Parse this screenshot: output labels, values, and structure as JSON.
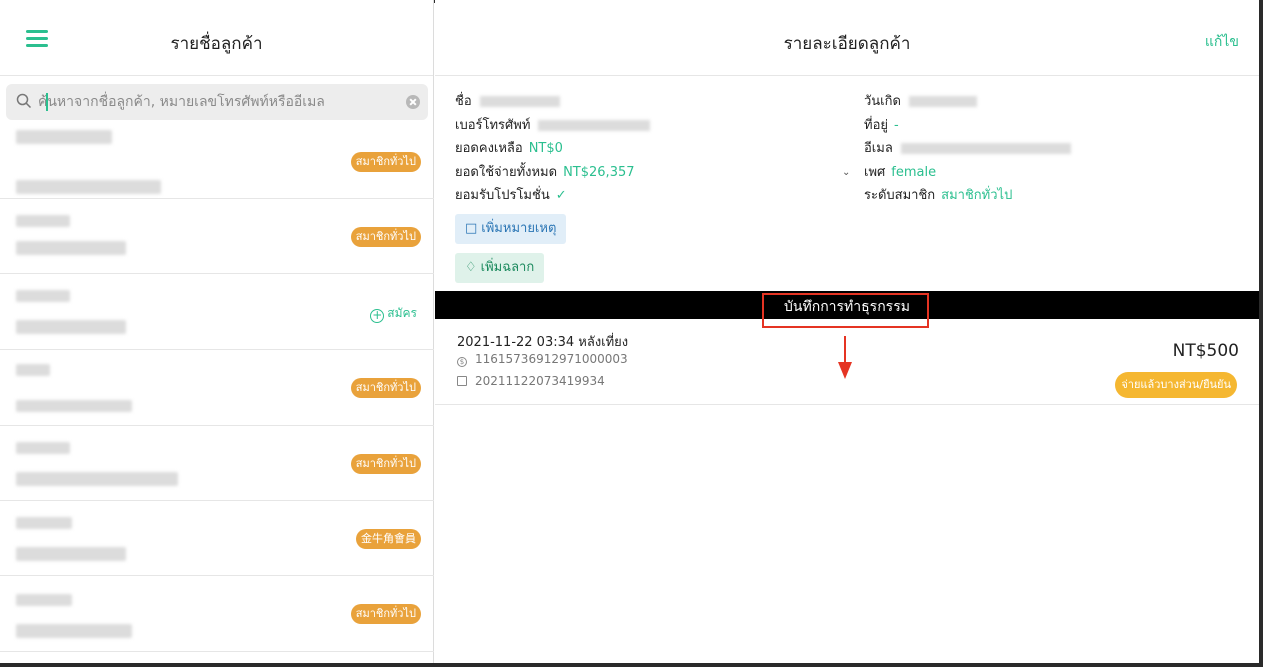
{
  "left_panel": {
    "title": "รายชื่อลูกค้า",
    "search_placeholder": "ค้นหาจากชื่อลูกค้า, หมายเลขโทรศัพท์หรืออีเมล",
    "register_label": "สมัคร",
    "customers": [
      {
        "badge": "สมาชิกทั่วไป"
      },
      {
        "badge": "สมาชิกทั่วไป"
      },
      {
        "badge": ""
      },
      {
        "badge": "สมาชิกทั่วไป"
      },
      {
        "badge": "สมาชิกทั่วไป"
      },
      {
        "badge": "金牛角會員"
      },
      {
        "badge": "สมาชิกทั่วไป"
      }
    ]
  },
  "right_panel": {
    "title": "รายละเอียดลูกค้า",
    "edit_label": "แก้ไข",
    "left_info": {
      "name_label": "ชื่อ",
      "phone_label": "เบอร์โทรศัพท์",
      "balance_label": "ยอดคงเหลือ",
      "balance_value": "NT$0",
      "total_spent_label": "ยอดใช้จ่ายทั้งหมด",
      "total_spent_value": "NT$26,357",
      "promo_label": "ยอมรับโปรโมชั่น",
      "promo_value": "✓"
    },
    "right_info": {
      "birthday_label": "วันเกิด",
      "address_label": "ที่อยู่",
      "address_value": "-",
      "email_label": "อีเมล",
      "gender_label": "เพศ",
      "gender_value": "female",
      "level_label": "ระดับสมาชิก",
      "level_value": "สมาชิกทั่วไป"
    },
    "add_note_label": "เพิ่มหมายเหตุ",
    "add_tag_label": "เพิ่มฉลาก",
    "section_title": "บันทึกการทำธุรกรรม",
    "transaction": {
      "datetime": "2021-11-22 03:34 หลังเที่ยง",
      "transaction_id": "11615736912971000003",
      "order_no": "20211122073419934",
      "amount": "NT$500",
      "status": "จ่ายแล้วบางส่วน/ยืนยัน"
    }
  },
  "colors": {
    "accent_green": "#2bbf8f",
    "badge_orange": "#e9a23b",
    "status_yellow": "#f5b731",
    "highlight_red": "#e53423"
  }
}
